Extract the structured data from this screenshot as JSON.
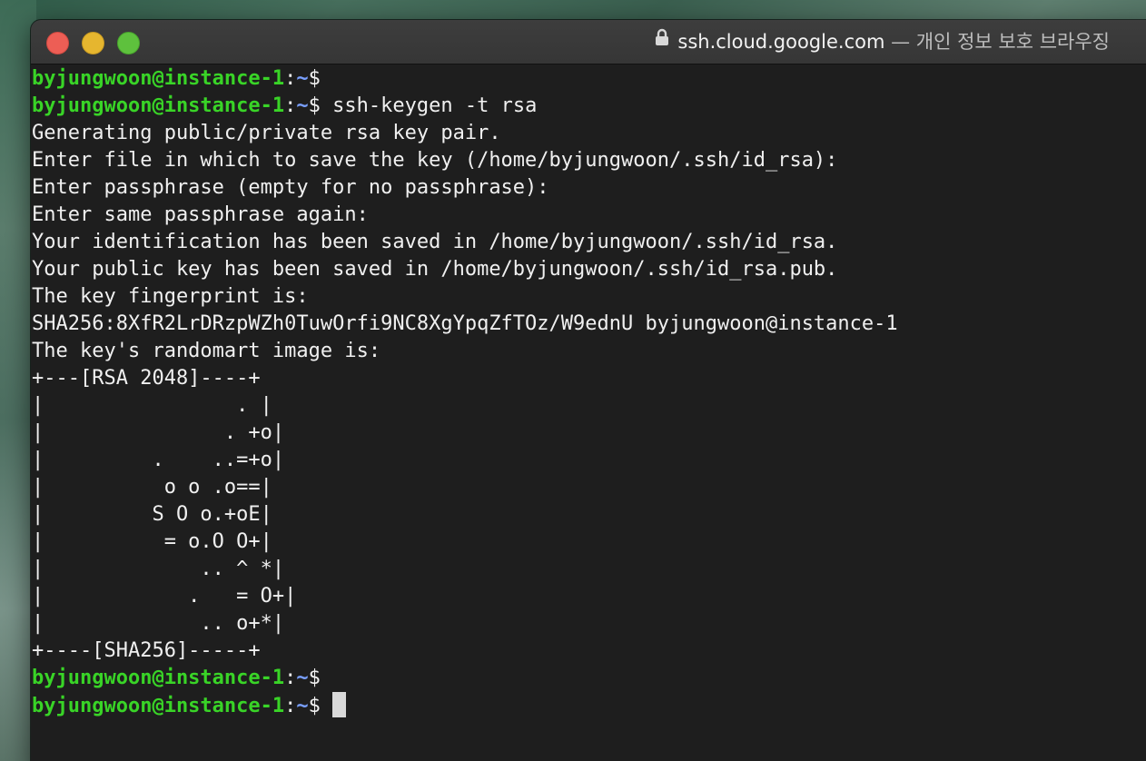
{
  "window": {
    "host": "ssh.cloud.google.com",
    "suffix": " — 개인 정보 보호 브라우징",
    "lock_icon": "lock-icon"
  },
  "prompt": {
    "user": "byjungwoon@instance-1",
    "colon": ":",
    "path": "~",
    "symbol": "$"
  },
  "lines": [
    {
      "type": "prompt",
      "cmd": ""
    },
    {
      "type": "prompt",
      "cmd": " ssh-keygen -t rsa"
    },
    {
      "type": "out",
      "text": "Generating public/private rsa key pair."
    },
    {
      "type": "out",
      "text": "Enter file in which to save the key (/home/byjungwoon/.ssh/id_rsa):"
    },
    {
      "type": "out",
      "text": "Enter passphrase (empty for no passphrase):"
    },
    {
      "type": "out",
      "text": "Enter same passphrase again:"
    },
    {
      "type": "out",
      "text": "Your identification has been saved in /home/byjungwoon/.ssh/id_rsa."
    },
    {
      "type": "out",
      "text": "Your public key has been saved in /home/byjungwoon/.ssh/id_rsa.pub."
    },
    {
      "type": "out",
      "text": "The key fingerprint is:"
    },
    {
      "type": "out",
      "text": "SHA256:8XfR2LrDRzpWZh0TuwOrfi9NC8XgYpqZfTOz/W9ednU byjungwoon@instance-1"
    },
    {
      "type": "out",
      "text": "The key's randomart image is:"
    },
    {
      "type": "out",
      "text": "+---[RSA 2048]----+"
    },
    {
      "type": "out",
      "text": "|                . |"
    },
    {
      "type": "out",
      "text": "|               . +o|"
    },
    {
      "type": "out",
      "text": "|         .    ..=+o|"
    },
    {
      "type": "out",
      "text": "|          o o .o==|"
    },
    {
      "type": "out",
      "text": "|         S O o.+oE|"
    },
    {
      "type": "out",
      "text": "|          = o.O O+|"
    },
    {
      "type": "out",
      "text": "|             .. ^ *|"
    },
    {
      "type": "out",
      "text": "|            .   = O+|"
    },
    {
      "type": "out",
      "text": "|             .. o+*|"
    },
    {
      "type": "out",
      "text": "+----[SHA256]-----+"
    },
    {
      "type": "prompt",
      "cmd": ""
    },
    {
      "type": "prompt",
      "cmd": " ",
      "cursor": true
    }
  ]
}
